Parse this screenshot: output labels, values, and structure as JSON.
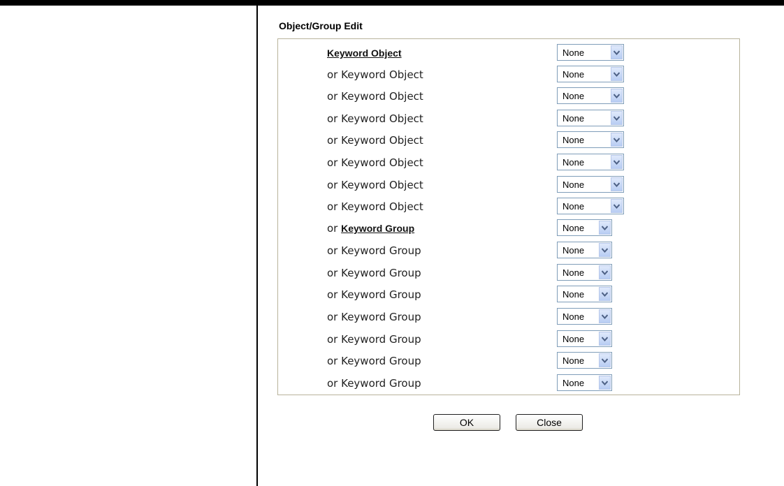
{
  "section_title": "Object/Group Edit",
  "rows": [
    {
      "prefix": "",
      "link": "Keyword Object",
      "label": "",
      "value": "None",
      "kind": "object"
    },
    {
      "prefix": "",
      "link": "",
      "label": "or Keyword Object",
      "value": "None",
      "kind": "object"
    },
    {
      "prefix": "",
      "link": "",
      "label": "or Keyword Object",
      "value": "None",
      "kind": "object"
    },
    {
      "prefix": "",
      "link": "",
      "label": "or Keyword Object",
      "value": "None",
      "kind": "object"
    },
    {
      "prefix": "",
      "link": "",
      "label": "or Keyword Object",
      "value": "None",
      "kind": "object"
    },
    {
      "prefix": "",
      "link": "",
      "label": "or Keyword Object",
      "value": "None",
      "kind": "object"
    },
    {
      "prefix": "",
      "link": "",
      "label": "or Keyword Object",
      "value": "None",
      "kind": "object"
    },
    {
      "prefix": "",
      "link": "",
      "label": "or Keyword Object",
      "value": "None",
      "kind": "object"
    },
    {
      "prefix": "or ",
      "link": "Keyword Group",
      "label": "",
      "value": "None",
      "kind": "group"
    },
    {
      "prefix": "",
      "link": "",
      "label": "or Keyword Group",
      "value": "None",
      "kind": "group"
    },
    {
      "prefix": "",
      "link": "",
      "label": "or Keyword Group",
      "value": "None",
      "kind": "group"
    },
    {
      "prefix": "",
      "link": "",
      "label": "or Keyword Group",
      "value": "None",
      "kind": "group"
    },
    {
      "prefix": "",
      "link": "",
      "label": "or Keyword Group",
      "value": "None",
      "kind": "group"
    },
    {
      "prefix": "",
      "link": "",
      "label": "or Keyword Group",
      "value": "None",
      "kind": "group"
    },
    {
      "prefix": "",
      "link": "",
      "label": "or Keyword Group",
      "value": "None",
      "kind": "group"
    },
    {
      "prefix": "",
      "link": "",
      "label": "or Keyword Group",
      "value": "None",
      "kind": "group"
    }
  ],
  "buttons": {
    "ok_label": "OK",
    "close_label": "Close"
  },
  "colors": {
    "panel_border": "#b8b39b",
    "select_border": "#7f9db9",
    "arrow_fill": "#c7d7f7"
  },
  "icons": {
    "dropdown": "chevron-down-icon"
  }
}
